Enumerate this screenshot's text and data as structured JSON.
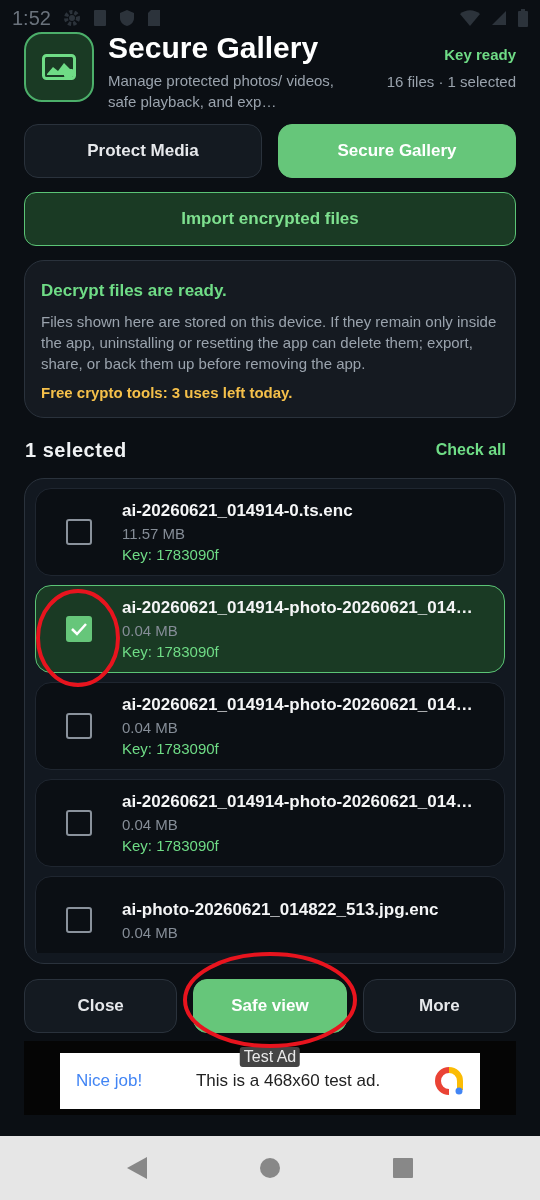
{
  "status_bar": {
    "time": "1:52"
  },
  "header": {
    "title": "Secure Gallery",
    "subtitle": "Manage protected photos/ videos, safe playback, and exp…",
    "status": "Key ready",
    "summary": "16 files · 1 selected"
  },
  "tabs": [
    {
      "label": "Protect Media",
      "selected": false
    },
    {
      "label": "Secure Gallery",
      "selected": true
    }
  ],
  "import_button": "Import encrypted files",
  "notice": {
    "title": "Decrypt files are ready.",
    "body": "Files shown here are stored on this device. If they remain only inside the app, uninstalling or resetting the app can delete them; export, share, or back them up before removing the app.",
    "warning": "Free crypto tools: 3 uses left today."
  },
  "selection": {
    "count": "1 selected",
    "check_all": "Check all"
  },
  "files": [
    {
      "name": "ai-20260621_014914-0.ts.enc",
      "size": "11.57 MB",
      "key": "Key: 1783090f",
      "selected": false
    },
    {
      "name": "ai-20260621_014914-photo-20260621_014…",
      "size": "0.04 MB",
      "key": "Key: 1783090f",
      "selected": true
    },
    {
      "name": "ai-20260621_014914-photo-20260621_014…",
      "size": "0.04 MB",
      "key": "Key: 1783090f",
      "selected": false
    },
    {
      "name": "ai-20260621_014914-photo-20260621_014…",
      "size": "0.04 MB",
      "key": "Key: 1783090f",
      "selected": false
    },
    {
      "name": "ai-photo-20260621_014822_513.jpg.enc",
      "size": "0.04 MB",
      "selected": false
    }
  ],
  "actions": [
    {
      "label": "Close",
      "kind": "secondary"
    },
    {
      "label": "Safe view",
      "kind": "primary"
    },
    {
      "label": "More",
      "kind": "secondary"
    }
  ],
  "ad": {
    "tag": "Test Ad",
    "headline": "Nice job!",
    "text": "This is a 468x60 test ad."
  }
}
